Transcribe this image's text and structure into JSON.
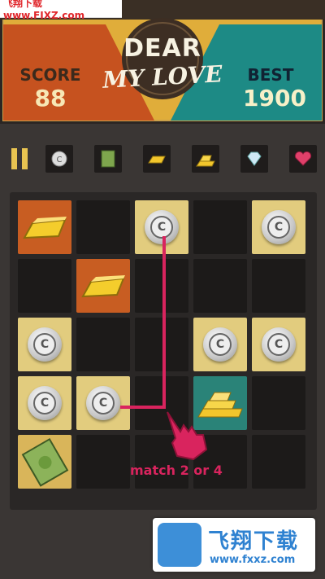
{
  "watermark_top": "飞翔下载 www.FIXZ.com",
  "header": {
    "score_label": "SCORE",
    "score_value": "88",
    "best_label": "BEST",
    "best_value": "1900",
    "title_line1": "DEAR",
    "title_line2": "MY LOVE"
  },
  "item_bar": {
    "pause_icon": "pause-icon",
    "items": [
      "coin-icon",
      "cash-stack-icon",
      "gold-bar-icon",
      "gold-bars-icon",
      "diamond-icon",
      "heart-gem-icon"
    ]
  },
  "board": {
    "rows": [
      [
        "gold-bar",
        "empty",
        "coin",
        "empty",
        "coin"
      ],
      [
        "empty",
        "gold-bar",
        "empty",
        "empty",
        "empty"
      ],
      [
        "coin",
        "empty",
        "empty",
        "coin",
        "coin"
      ],
      [
        "coin",
        "coin",
        "empty",
        "gold-pile",
        "empty"
      ],
      [
        "cash",
        "empty",
        "empty",
        "empty",
        "empty"
      ]
    ]
  },
  "hint_text": "match 2 or 4",
  "coin_letter": "C",
  "brand": {
    "name": "飞翔下载",
    "url": "www.fxxz.com"
  },
  "colors": {
    "accent_pink": "#d9245e",
    "gold_tile": "#e2cc7e",
    "orange_tile": "#c85d22",
    "teal_tile": "#2a8378"
  }
}
